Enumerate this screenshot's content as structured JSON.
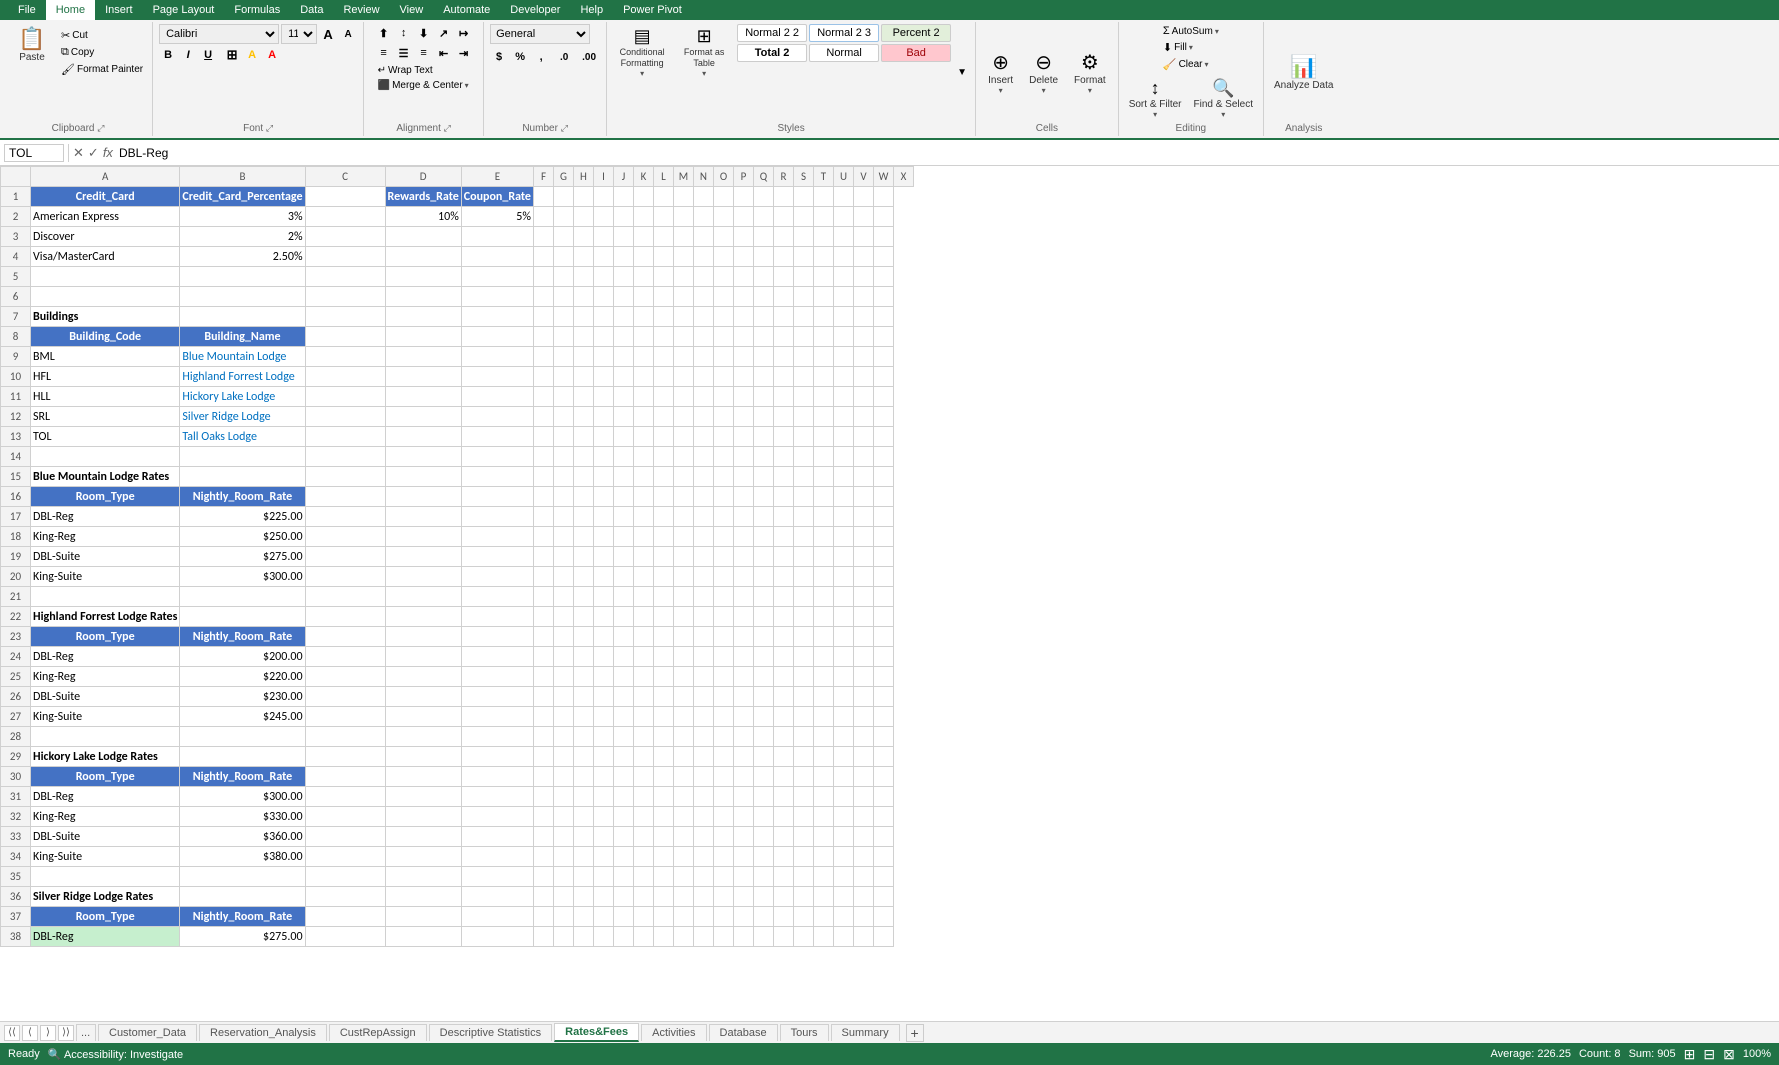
{
  "ribbon": {
    "tabs": [
      "File",
      "Home",
      "Insert",
      "Page Layout",
      "Formulas",
      "Data",
      "Review",
      "View",
      "Automate",
      "Developer",
      "Help",
      "Power Pivot"
    ],
    "active_tab": "Home",
    "groups": {
      "clipboard": {
        "label": "Clipboard",
        "paste_label": "Paste",
        "cut_label": "Cut",
        "copy_label": "Copy",
        "format_painter_label": "Format Painter"
      },
      "font": {
        "label": "Font",
        "font_name": "Calibri",
        "font_size": "11",
        "bold": "B",
        "italic": "I",
        "underline": "U",
        "borders": "⊞",
        "fill_color": "A",
        "font_color": "A"
      },
      "alignment": {
        "label": "Alignment",
        "wrap_text": "Wrap Text",
        "merge_center": "Merge & Center"
      },
      "number": {
        "label": "Number",
        "format": "General",
        "dollar": "$",
        "percent": "%",
        "comma": ",",
        "increase_decimal": ".0",
        "decrease_decimal": ".00"
      },
      "styles": {
        "label": "Styles",
        "conditional_formatting": "Conditional Formatting",
        "format_table": "Format as Table",
        "normal22_label": "Normal 2 2",
        "normal23_label": "Normal 2 3",
        "percent2_label": "Percent 2",
        "total2_label": "Total 2",
        "normal_label": "Normal",
        "bad_label": "Bad"
      },
      "cells": {
        "label": "Cells",
        "insert_label": "Insert",
        "delete_label": "Delete",
        "format_label": "Format"
      },
      "editing": {
        "label": "Editing",
        "autosum_label": "AutoSum",
        "fill_label": "Fill",
        "clear_label": "Clear",
        "sort_label": "Sort & Filter",
        "find_label": "Find & Select"
      },
      "analysis": {
        "label": "Analysis",
        "analyze_label": "Analyze Data"
      }
    }
  },
  "formula_bar": {
    "cell_ref": "TOL",
    "formula": "DBL-Reg"
  },
  "spreadsheet": {
    "col_headers": [
      "A",
      "B",
      "C",
      "D",
      "E",
      "F",
      "G",
      "H",
      "I",
      "J",
      "K",
      "L",
      "M",
      "N",
      "O",
      "P",
      "Q",
      "R",
      "S",
      "T",
      "U",
      "V",
      "W",
      "X"
    ],
    "rows": [
      {
        "row": 1,
        "cells": {
          "A": "Credit_Card",
          "B": "Credit_Card_Percentage",
          "C": "",
          "D": "Rewards_Rate",
          "E": "Coupon_Rate"
        }
      },
      {
        "row": 2,
        "cells": {
          "A": "American Express",
          "B": "3%",
          "C": "",
          "D": "10%",
          "E": "5%"
        }
      },
      {
        "row": 3,
        "cells": {
          "A": "Discover",
          "B": "2%",
          "C": "",
          "D": "",
          "E": ""
        }
      },
      {
        "row": 4,
        "cells": {
          "A": "Visa/MasterCard",
          "B": "2.50%",
          "C": "",
          "D": "",
          "E": ""
        }
      },
      {
        "row": 5,
        "cells": {}
      },
      {
        "row": 6,
        "cells": {}
      },
      {
        "row": 7,
        "cells": {
          "A": "Buildings"
        }
      },
      {
        "row": 8,
        "cells": {
          "A": "Building_Code",
          "B": "Building_Name"
        }
      },
      {
        "row": 9,
        "cells": {
          "A": "BML",
          "B": "Blue Mountain Lodge"
        }
      },
      {
        "row": 10,
        "cells": {
          "A": "HFL",
          "B": "Highland Forrest Lodge"
        }
      },
      {
        "row": 11,
        "cells": {
          "A": "HLL",
          "B": "Hickory Lake Lodge"
        }
      },
      {
        "row": 12,
        "cells": {
          "A": "SRL",
          "B": "Silver Ridge Lodge"
        }
      },
      {
        "row": 13,
        "cells": {
          "A": "TOL",
          "B": "Tall Oaks Lodge"
        }
      },
      {
        "row": 14,
        "cells": {}
      },
      {
        "row": 15,
        "cells": {
          "A": "Blue Mountain Lodge Rates"
        }
      },
      {
        "row": 16,
        "cells": {
          "A": "Room_Type",
          "B": "Nightly_Room_Rate"
        }
      },
      {
        "row": 17,
        "cells": {
          "A": "DBL-Reg",
          "B": "$225.00"
        }
      },
      {
        "row": 18,
        "cells": {
          "A": "King-Reg",
          "B": "$250.00"
        }
      },
      {
        "row": 19,
        "cells": {
          "A": "DBL-Suite",
          "B": "$275.00"
        }
      },
      {
        "row": 20,
        "cells": {
          "A": "King-Suite",
          "B": "$300.00"
        }
      },
      {
        "row": 21,
        "cells": {}
      },
      {
        "row": 22,
        "cells": {
          "A": "Highland Forrest Lodge Rates"
        }
      },
      {
        "row": 23,
        "cells": {
          "A": "Room_Type",
          "B": "Nightly_Room_Rate"
        }
      },
      {
        "row": 24,
        "cells": {
          "A": "DBL-Reg",
          "B": "$200.00"
        }
      },
      {
        "row": 25,
        "cells": {
          "A": "King-Reg",
          "B": "$220.00"
        }
      },
      {
        "row": 26,
        "cells": {
          "A": "DBL-Suite",
          "B": "$230.00"
        }
      },
      {
        "row": 27,
        "cells": {
          "A": "King-Suite",
          "B": "$245.00"
        }
      },
      {
        "row": 28,
        "cells": {}
      },
      {
        "row": 29,
        "cells": {
          "A": "Hickory Lake Lodge Rates"
        }
      },
      {
        "row": 30,
        "cells": {
          "A": "Room_Type",
          "B": "Nightly_Room_Rate"
        }
      },
      {
        "row": 31,
        "cells": {
          "A": "DBL-Reg",
          "B": "$300.00"
        }
      },
      {
        "row": 32,
        "cells": {
          "A": "King-Reg",
          "B": "$330.00"
        }
      },
      {
        "row": 33,
        "cells": {
          "A": "DBL-Suite",
          "B": "$360.00"
        }
      },
      {
        "row": 34,
        "cells": {
          "A": "King-Suite",
          "B": "$380.00"
        }
      },
      {
        "row": 35,
        "cells": {}
      },
      {
        "row": 36,
        "cells": {
          "A": "Silver Ridge Lodge Rates"
        }
      },
      {
        "row": 37,
        "cells": {
          "A": "Room_Type",
          "B": "Nightly_Room_Rate"
        }
      },
      {
        "row": 38,
        "cells": {
          "A": "DBL-Reg",
          "B": "$275.00"
        }
      }
    ]
  },
  "tabs": {
    "items": [
      "Customer_Data",
      "Reservation_Analysis",
      "CustRepAssign",
      "Descriptive Statistics",
      "Rates&Fees",
      "Activities",
      "Database",
      "Tours",
      "Summary"
    ],
    "active": "Rates&Fees",
    "hidden": "..."
  },
  "status_bar": {
    "ready": "Ready",
    "accessibility": "Accessibility: Investigate",
    "average": "Average: 226.25",
    "count": "Count: 8",
    "sum": "Sum: 905",
    "view_normal": "⊞",
    "view_page": "⊟",
    "view_page_layout": "⊠",
    "zoom": "100%"
  }
}
